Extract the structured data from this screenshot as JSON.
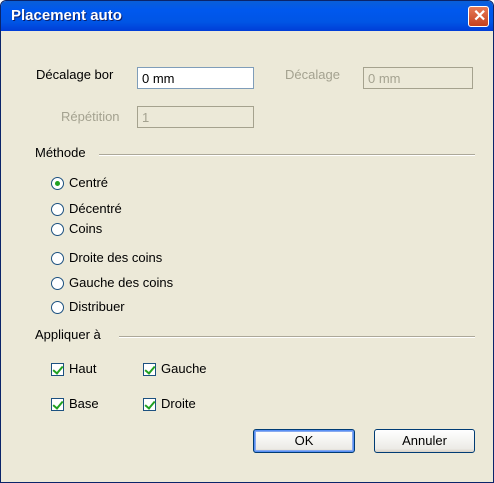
{
  "window": {
    "title": "Placement auto",
    "close_glyph": "✕"
  },
  "offset": {
    "label": "Décalage bor",
    "value": "0 mm",
    "secondary_label": "Décalage",
    "secondary_value": "0 mm"
  },
  "repeat": {
    "label": "Répétition",
    "value": "1"
  },
  "method": {
    "title": "Méthode",
    "selected_index": 0,
    "options": [
      "Centré",
      "Décentré",
      "Coins",
      "Droite des coins",
      "Gauche des coins",
      "Distribuer"
    ]
  },
  "apply": {
    "title": "Appliquer à",
    "top": {
      "label": "Haut",
      "checked": true
    },
    "left": {
      "label": "Gauche",
      "checked": true
    },
    "bottom": {
      "label": "Base",
      "checked": true
    },
    "right": {
      "label": "Droite",
      "checked": true
    }
  },
  "buttons": {
    "ok": "OK",
    "cancel": "Annuler"
  },
  "colors": {
    "titlebar": "#0058ee",
    "close": "#c4401d",
    "face": "#ece9d8",
    "check": "#21a121"
  }
}
